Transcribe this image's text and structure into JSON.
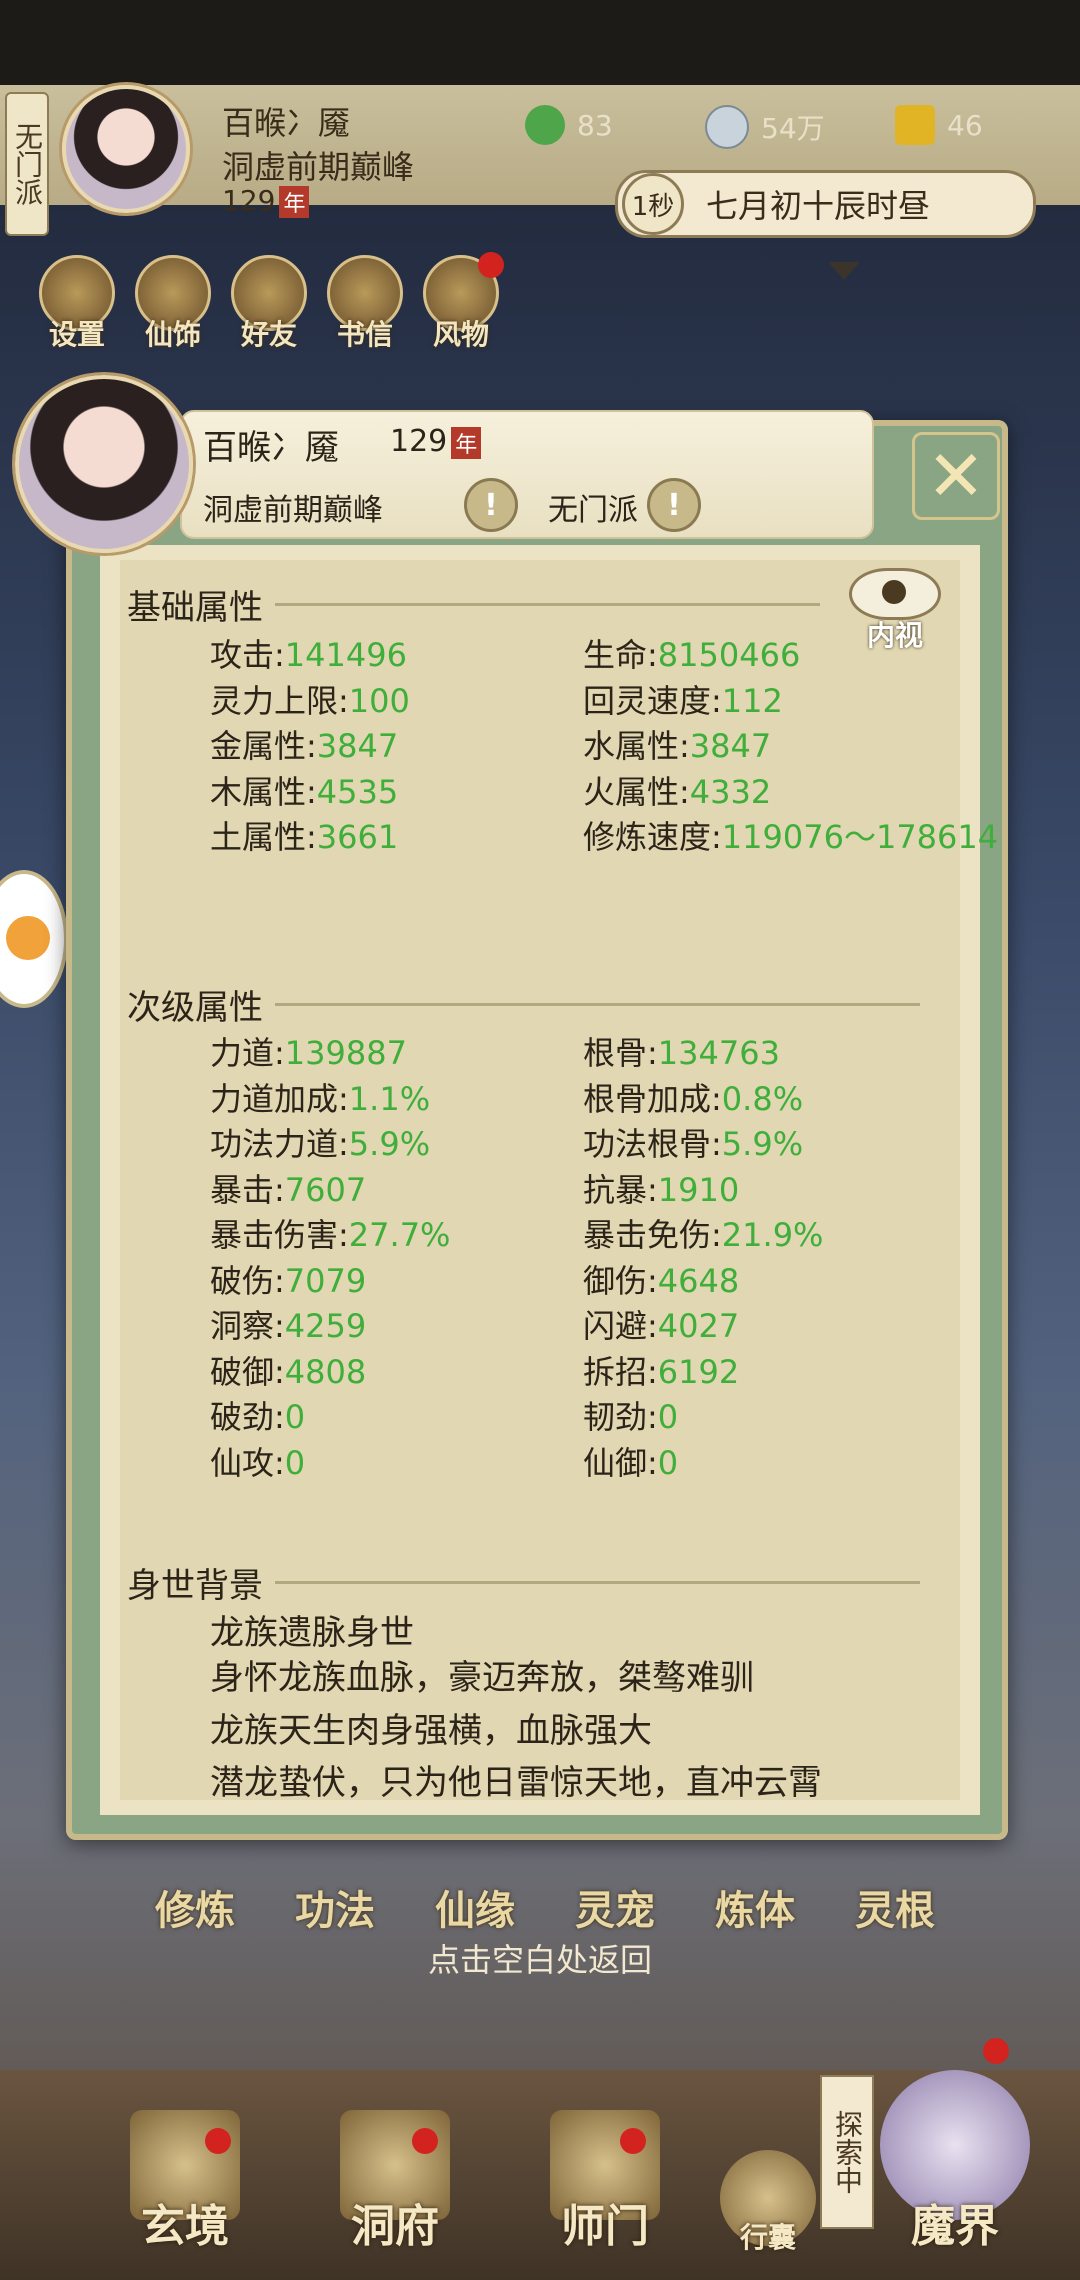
{
  "topbar": {
    "sect_tag": "无门派",
    "player_name": "百㬋冫魇",
    "realm": "洞虚前期巅峰",
    "age": "129",
    "age_badge": "年",
    "resources": [
      {
        "icon": "leaf-icon",
        "value": "83"
      },
      {
        "icon": "coin-icon",
        "value": "54万"
      },
      {
        "icon": "trophy-icon",
        "value": "46"
      }
    ],
    "time_speed": "1秒",
    "time_text": "七月初十辰时昼",
    "menu": [
      "设置",
      "仙饰",
      "好友",
      "书信",
      "风物"
    ]
  },
  "dialog": {
    "name": "百㬋冫魇",
    "age": "129",
    "age_badge": "年",
    "realm": "洞虚前期巅峰",
    "sect": "无门派",
    "eye_label": "内视",
    "basic_title": "基础属性",
    "basic_attrs": [
      {
        "label": "攻击",
        "value": "141496"
      },
      {
        "label": "生命",
        "value": "8150466"
      },
      {
        "label": "灵力上限",
        "value": "100"
      },
      {
        "label": "回灵速度",
        "value": "112"
      },
      {
        "label": "金属性",
        "value": "3847"
      },
      {
        "label": "水属性",
        "value": "3847"
      },
      {
        "label": "木属性",
        "value": "4535"
      },
      {
        "label": "火属性",
        "value": "4332"
      },
      {
        "label": "土属性",
        "value": "3661"
      },
      {
        "label": "修炼速度",
        "value": "119076～178614"
      }
    ],
    "secondary_title": "次级属性",
    "secondary_attrs": [
      {
        "label": "力道",
        "value": "139887"
      },
      {
        "label": "根骨",
        "value": "134763"
      },
      {
        "label": "力道加成",
        "value": "1.1%"
      },
      {
        "label": "根骨加成",
        "value": "0.8%"
      },
      {
        "label": "功法力道",
        "value": "5.9%"
      },
      {
        "label": "功法根骨",
        "value": "5.9%"
      },
      {
        "label": "暴击",
        "value": "7607"
      },
      {
        "label": "抗暴",
        "value": "1910"
      },
      {
        "label": "暴击伤害",
        "value": "27.7%"
      },
      {
        "label": "暴击免伤",
        "value": "21.9%"
      },
      {
        "label": "破伤",
        "value": "7079"
      },
      {
        "label": "御伤",
        "value": "4648"
      },
      {
        "label": "洞察",
        "value": "4259"
      },
      {
        "label": "闪避",
        "value": "4027"
      },
      {
        "label": "破御",
        "value": "4808"
      },
      {
        "label": "拆招",
        "value": "6192"
      },
      {
        "label": "破劲",
        "value": "0"
      },
      {
        "label": "韧劲",
        "value": "0"
      },
      {
        "label": "仙攻",
        "value": "0"
      },
      {
        "label": "仙御",
        "value": "0"
      }
    ],
    "background_title": "身世背景",
    "background_lines": [
      "龙族遗脉身世",
      "身怀龙族血脉，豪迈奔放，桀骜难驯",
      "龙族天生肉身强横，血脉强大",
      "潜龙蛰伏，只为他日雷惊天地，直冲云霄"
    ]
  },
  "tabs": [
    "修炼",
    "功法",
    "仙缘",
    "灵宠",
    "炼体",
    "灵根"
  ],
  "hint": "点击空白处返回",
  "bottom_nav": [
    "玄境",
    "洞府",
    "师门",
    "行囊",
    "魔界"
  ],
  "explore_label": "探索中",
  "colors": {
    "value_green": "#3fae3a",
    "frame_green": "#8aa583",
    "badge_red": "#b33a2a"
  }
}
